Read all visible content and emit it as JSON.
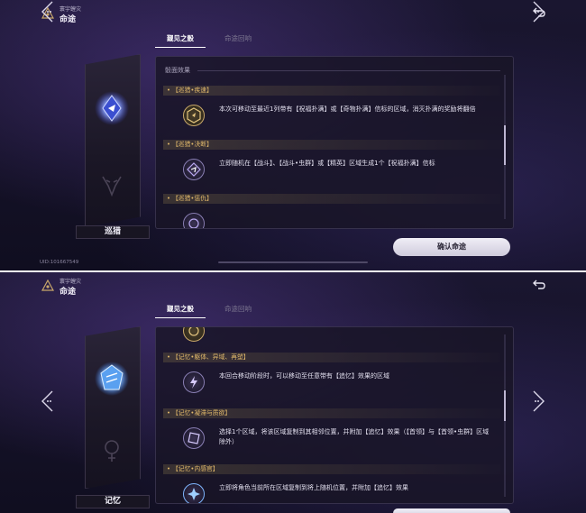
{
  "panels": [
    {
      "app": {
        "subtitle": "寰宇蝗灾",
        "title": "命途"
      },
      "tabs": [
        {
          "label": "觐见之骰"
        },
        {
          "label": "命途回响"
        }
      ],
      "path_name": "巡猎",
      "section_title": "骰面效果",
      "effects": [
        {
          "title": "【巡猎•疾速】",
          "text": "本次可移动至最近1列带有【祝福扑满】或【奇物扑满】信标的区域，消灭扑满的奖励将翻倍",
          "icon": "gold-hexagon-icon"
        },
        {
          "title": "【巡猎•决断】",
          "text": "立即随机在【战斗】、【战斗•虫群】或【精英】区域生成1个【祝福扑满】信标",
          "icon": "purple-arrow-icon"
        },
        {
          "title": "【巡猎•惩仇】",
          "text": "",
          "icon": "purple-circle-icon"
        }
      ],
      "uid": "UID:101667549",
      "confirm_label": "确认命途"
    },
    {
      "app": {
        "subtitle": "寰宇蝗灾",
        "title": "命途"
      },
      "tabs": [
        {
          "label": "觐见之骰"
        },
        {
          "label": "命途回响"
        }
      ],
      "path_name": "记忆",
      "effects": [
        {
          "title": "",
          "text": "",
          "icon": "gold-circle-icon"
        },
        {
          "title": "【记忆•躯体、异域、再塑】",
          "text": "本回合移动阶段时，可以移动至任意带有【追忆】效果的区域",
          "icon": "purple-lightning-icon"
        },
        {
          "title": "【记忆•凝滞与质欲】",
          "text": "选择1个区域，将该区域复制到其相邻位置，并附加【追忆】效果（【首领】与【首领•虫群】区域除外）",
          "icon": "purple-square-icon"
        },
        {
          "title": "【记忆•内感官】",
          "text": "立即将角色当前所在区域复制到将上随机位置，并附加【追忆】效果",
          "icon": "blue-star-icon"
        }
      ],
      "confirm_label": ""
    }
  ]
}
